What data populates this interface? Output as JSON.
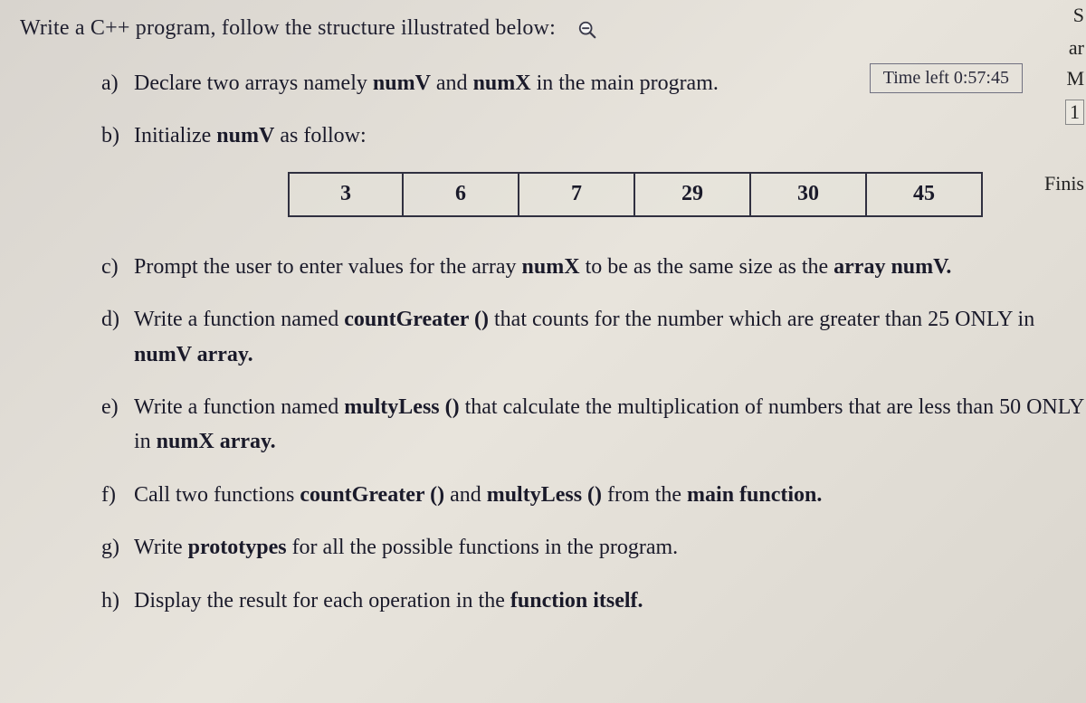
{
  "intro": "Write a C++ program, follow the structure illustrated below:",
  "time_left_label": "Time left 0:57:45",
  "items": {
    "a": {
      "letter": "a)",
      "pre": "Declare two arrays namely ",
      "b1": "numV",
      "mid": " and ",
      "b2": "numX",
      "post": " in the main program."
    },
    "b": {
      "letter": "b)",
      "pre": "Initialize ",
      "b1": "numV",
      "post": " as follow:"
    },
    "c": {
      "letter": "c)",
      "pre": "Prompt the user to enter values for the array ",
      "b1": "numX",
      "mid": " to be as the same size as the ",
      "b2": "array numV."
    },
    "d": {
      "letter": "d)",
      "pre": "Write a function named ",
      "b1": "countGreater ()",
      "mid": " that counts for the number which are greater than 25 ONLY in ",
      "b2": "numV array."
    },
    "e": {
      "letter": "e)",
      "pre": "Write a function named ",
      "b1": "multyLess ()",
      "mid": " that calculate the multiplication of numbers that are less than 50 ONLY in ",
      "b2": "numX array."
    },
    "f": {
      "letter": "f)",
      "pre": "Call two functions ",
      "b1": "countGreater ()",
      "mid": " and ",
      "b2": "multyLess ()",
      "post": " from the ",
      "b3": "main function."
    },
    "g": {
      "letter": "g)",
      "pre": "Write ",
      "b1": "prototypes",
      "post": " for all the possible functions in the program."
    },
    "h": {
      "letter": "h)",
      "pre": "Display the result for each operation in the ",
      "b1": "function itself."
    }
  },
  "numV": [
    "3",
    "6",
    "7",
    "29",
    "30",
    "45"
  ],
  "right_strip": {
    "l1": "S",
    "l2": "ar",
    "l3": "M",
    "l4": "1",
    "l5": "Finis"
  }
}
